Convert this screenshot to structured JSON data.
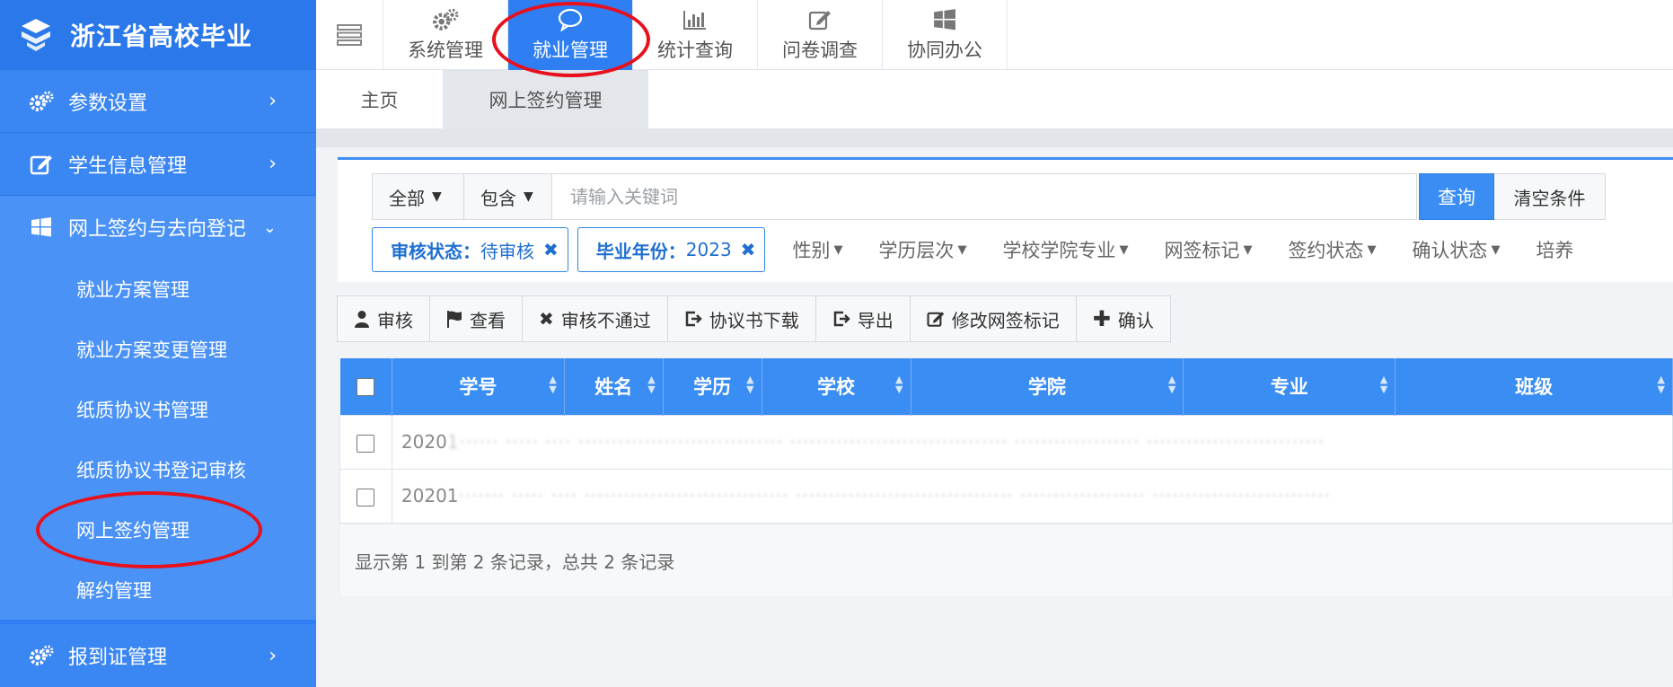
{
  "brand": {
    "title": "浙江省高校毕业"
  },
  "sidebar": {
    "items": [
      {
        "label": "参数设置",
        "icon": "gears-icon"
      },
      {
        "label": "学生信息管理",
        "icon": "edit-icon"
      },
      {
        "label": "网上签约与去向登记",
        "icon": "windows-icon"
      }
    ],
    "submenu": [
      "就业方案管理",
      "就业方案变更管理",
      "纸质协议书管理",
      "纸质协议书登记审核",
      "网上签约管理",
      "解约管理"
    ],
    "bottom": {
      "label": "报到证管理",
      "icon": "gears-icon"
    }
  },
  "topnav": [
    {
      "label": "系统管理",
      "icon": "gears-icon"
    },
    {
      "label": "就业管理",
      "icon": "chat-bubble-icon",
      "active": true
    },
    {
      "label": "统计查询",
      "icon": "bar-chart-icon"
    },
    {
      "label": "问卷调查",
      "icon": "edit-icon"
    },
    {
      "label": "协同办公",
      "icon": "windows-icon"
    }
  ],
  "tabs": {
    "home": "主页",
    "active": "网上签约管理"
  },
  "search": {
    "scope": "全部",
    "match": "包含",
    "placeholder": "请输入关键词",
    "query_label": "查询",
    "clear_label": "清空条件"
  },
  "chips": [
    {
      "key": "审核状态：",
      "value": "待审核"
    },
    {
      "key": "毕业年份：",
      "value": "2023"
    }
  ],
  "filters": [
    "性别",
    "学历层次",
    "学校学院专业",
    "网签标记",
    "签约状态",
    "确认状态",
    "培养"
  ],
  "actions": [
    "审核",
    "查看",
    "审核不通过",
    "协议书下载",
    "导出",
    "修改网签标记",
    "确认"
  ],
  "table": {
    "columns": [
      "学号",
      "姓名",
      "学历",
      "学校",
      "学院",
      "专业",
      "班级"
    ],
    "rows": [
      {
        "id_prefix": "2020",
        "masked": "1······  ·····  ···· ·······························  ·································  ···················  ···························"
      },
      {
        "id_prefix": "20201",
        "masked": "·······  ·····  ···· ·······························  ·································  ···················  ···························"
      }
    ]
  },
  "footer": {
    "summary": "显示第 1 到第 2 条记录，总共 2 条记录"
  },
  "colors": {
    "primary": "#2f7ff2",
    "annotation": "#e8101c"
  }
}
